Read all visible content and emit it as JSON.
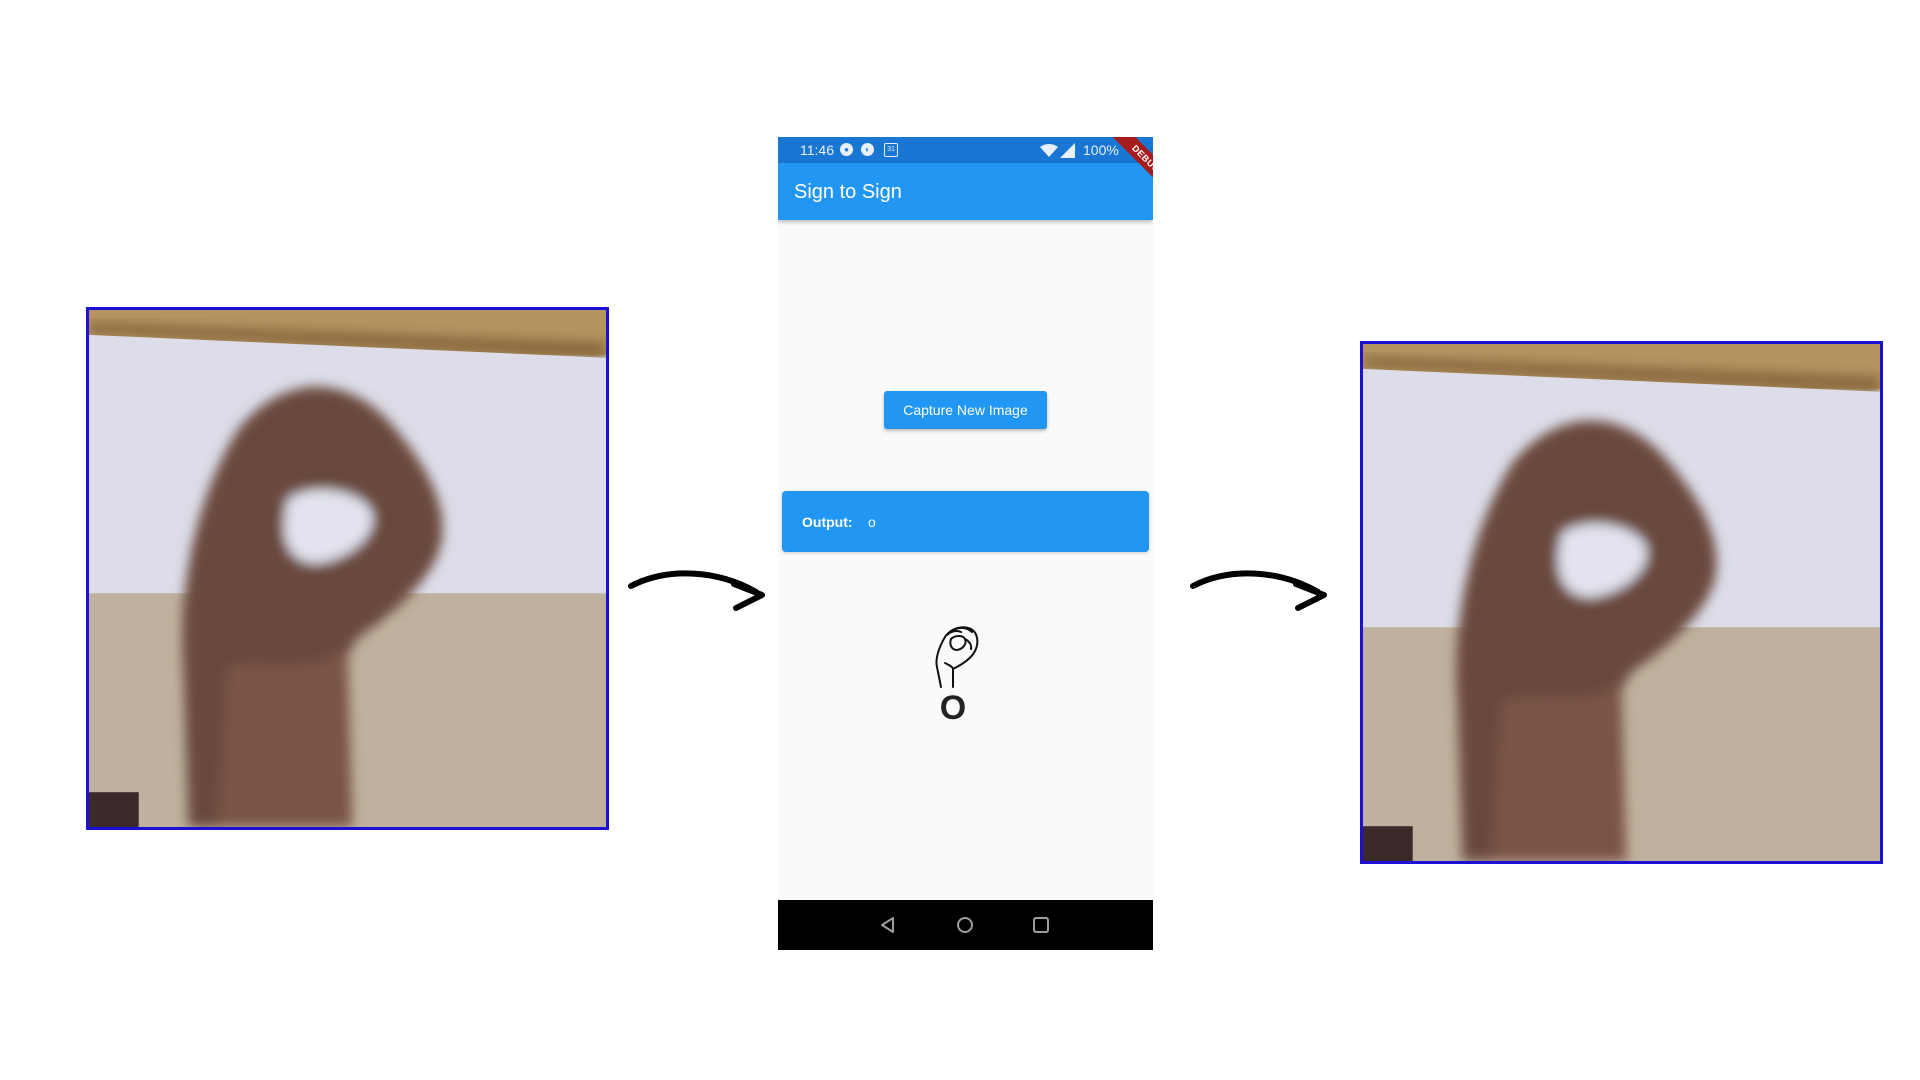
{
  "status_bar": {
    "time": "11:46",
    "battery": "100%",
    "calendar_day": "31",
    "icons": [
      "messaging-icon",
      "assistant-icon",
      "calendar-icon",
      "wifi-icon",
      "signal-icon"
    ]
  },
  "debug_banner": "DEBUG",
  "app_bar": {
    "title": "Sign to Sign"
  },
  "capture_button": {
    "label": "Capture New Image"
  },
  "output": {
    "label": "Output:",
    "value": "o"
  },
  "sign_result": {
    "letter": "O",
    "icon": "asl-hand-o-icon"
  },
  "nav": [
    "back-icon",
    "home-icon",
    "recent-apps-icon"
  ],
  "colors": {
    "primary": "#2196f3",
    "status_bar": "#1976d2",
    "photo_border": "#1c10d6",
    "debug_banner": "#a61b1b"
  }
}
